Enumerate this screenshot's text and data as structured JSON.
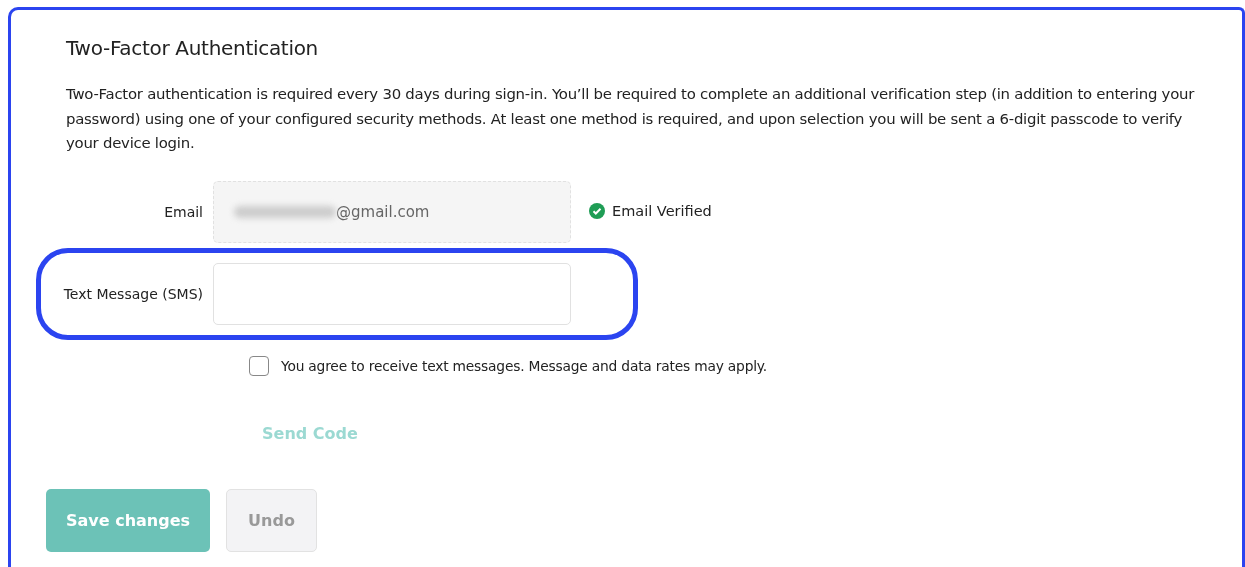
{
  "section": {
    "title": "Two-Factor Authentication",
    "description": "Two-Factor authentication is required every 30 days during sign-in. You’ll be required to complete an additional verification step (in addition to entering your password) using one of your configured security methods. At least one method is required, and upon selection you will be sent a 6-digit passcode to verify your device login."
  },
  "fields": [
    {
      "kind": "email",
      "label": "Email",
      "value": "@gmail.com",
      "redacted": true,
      "disabled": true,
      "highlighted": false,
      "status": "Email Verified"
    },
    {
      "kind": "phone",
      "label": "Text Message (SMS)",
      "disabled": false,
      "highlighted": true
    }
  ],
  "consent": {
    "label": "You agree to receive text messages. Message and data rates may apply.",
    "checked": false
  },
  "send_code": {
    "label": "Send Code",
    "disabled": true
  },
  "buttons": [
    {
      "kind": "primary",
      "label": "Save changes",
      "disabled": true
    },
    {
      "kind": "secondary",
      "label": "Undo",
      "disabled": true
    }
  ]
}
